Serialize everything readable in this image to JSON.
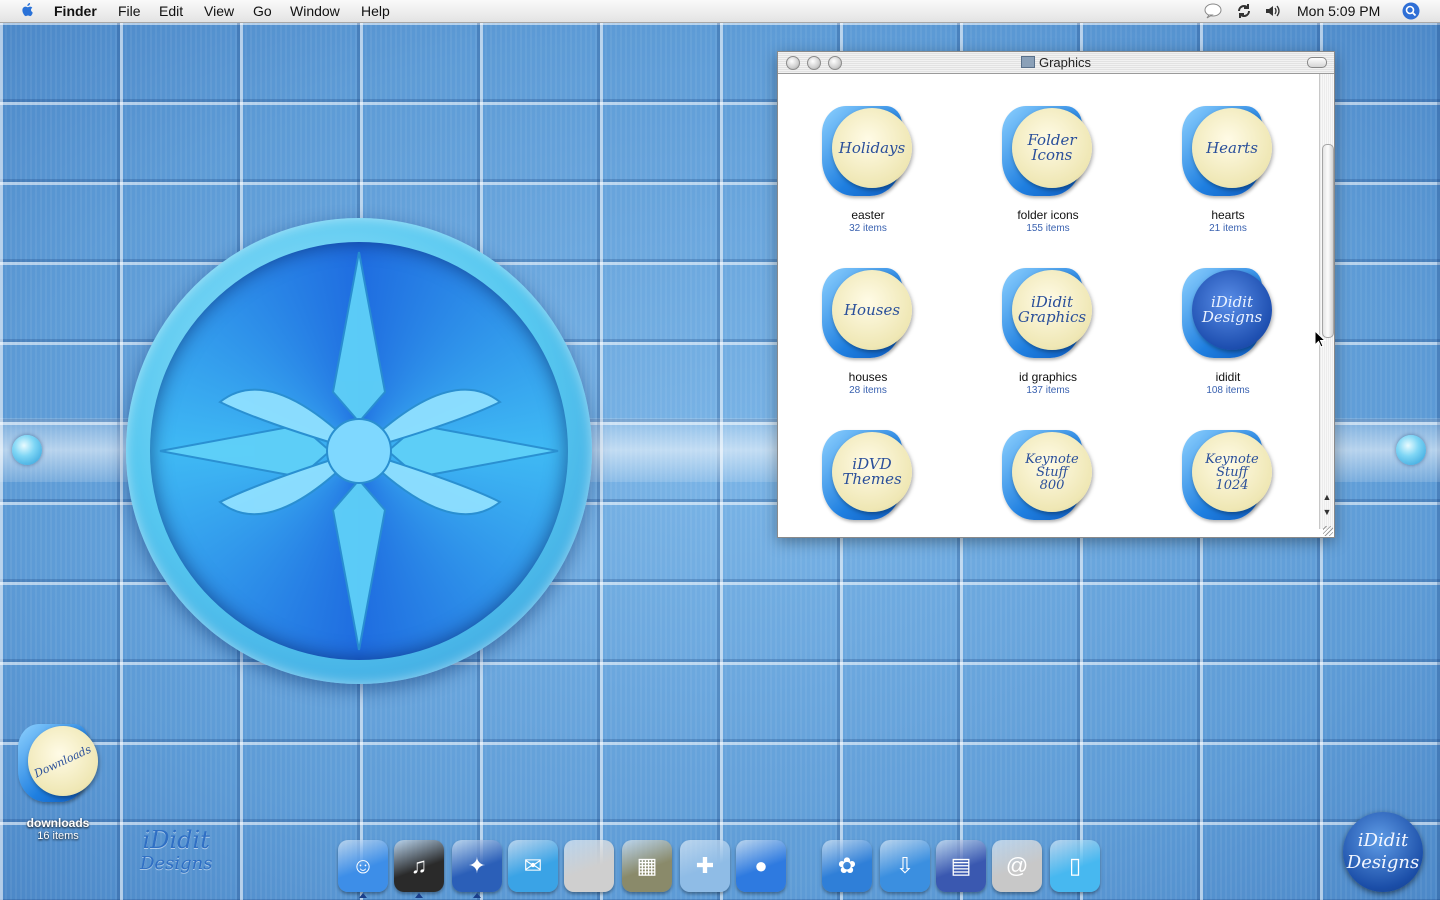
{
  "menubar": {
    "apple": "",
    "app": "Finder",
    "menus": [
      "File",
      "Edit",
      "View",
      "Go",
      "Window",
      "Help"
    ],
    "clock": "Mon 5:09 PM"
  },
  "window": {
    "title": "Graphics",
    "items": [
      {
        "name": "easter",
        "count": "32 items",
        "icon_text": "Holidays",
        "icon_style": "cream"
      },
      {
        "name": "folder icons",
        "count": "155 items",
        "icon_text": "Folder\nIcons",
        "icon_style": "cream"
      },
      {
        "name": "hearts",
        "count": "21 items",
        "icon_text": "Hearts",
        "icon_style": "cream"
      },
      {
        "name": "houses",
        "count": "28 items",
        "icon_text": "Houses",
        "icon_style": "cream"
      },
      {
        "name": "id graphics",
        "count": "137 items",
        "icon_text": "iDidit\nGraphics",
        "icon_style": "cream"
      },
      {
        "name": "ididit",
        "count": "108 items",
        "icon_text": "iDidit\nDesigns",
        "icon_style": "dark"
      },
      {
        "name": "",
        "count": "",
        "icon_text": "iDVD\nThemes",
        "icon_style": "cream"
      },
      {
        "name": "",
        "count": "",
        "icon_text": "Keynote\nStuff\n800",
        "icon_style": "cream"
      },
      {
        "name": "",
        "count": "",
        "icon_text": "Keynote\nStuff\n1024",
        "icon_style": "cream"
      }
    ],
    "scroll_up": "▲",
    "scroll_down": "▼"
  },
  "desktop": {
    "downloads": {
      "icon_text": "Downloads",
      "name": "downloads",
      "count": "16 items"
    },
    "brand_line1": "iDidit",
    "brand_line2": "Designs",
    "corner_line1": "iDidit",
    "corner_line2": "Designs"
  },
  "dock": {
    "apps": [
      {
        "name": "finder",
        "glyph": "☺",
        "color": "#3d8ee8",
        "running": true
      },
      {
        "name": "itunes",
        "glyph": "♫",
        "color": "#2a2a2a",
        "running": true
      },
      {
        "name": "safari",
        "glyph": "✦",
        "color": "#2b5fb8",
        "running": true
      },
      {
        "name": "mail",
        "glyph": "✉",
        "color": "#3aa3e6",
        "running": false
      },
      {
        "name": "system-preferences",
        "glyph": "",
        "color": "#cfcfcf",
        "running": false
      },
      {
        "name": "preview",
        "glyph": "▦",
        "color": "#8a8a6a",
        "running": false
      },
      {
        "name": "maps",
        "glyph": "✚",
        "color": "#8fbce6",
        "running": false
      },
      {
        "name": "ichat",
        "glyph": "●",
        "color": "#2e7ae0",
        "running": false
      },
      {
        "name": "cat-folder",
        "glyph": "✿",
        "color": "#2f7fd8",
        "running": false
      },
      {
        "name": "transfer-folder",
        "glyph": "⇩",
        "color": "#3b8fe0",
        "running": false
      },
      {
        "name": "working-files",
        "glyph": "▤",
        "color": "#3a58b0",
        "running": false
      },
      {
        "name": "mail-at",
        "glyph": "@",
        "color": "#c8c8c8",
        "running": false
      },
      {
        "name": "trash",
        "glyph": "▯",
        "color": "#47b8f0",
        "running": false
      }
    ]
  },
  "colors": {
    "accent": "#3a62b0",
    "desktop": "#5f9cd8"
  }
}
